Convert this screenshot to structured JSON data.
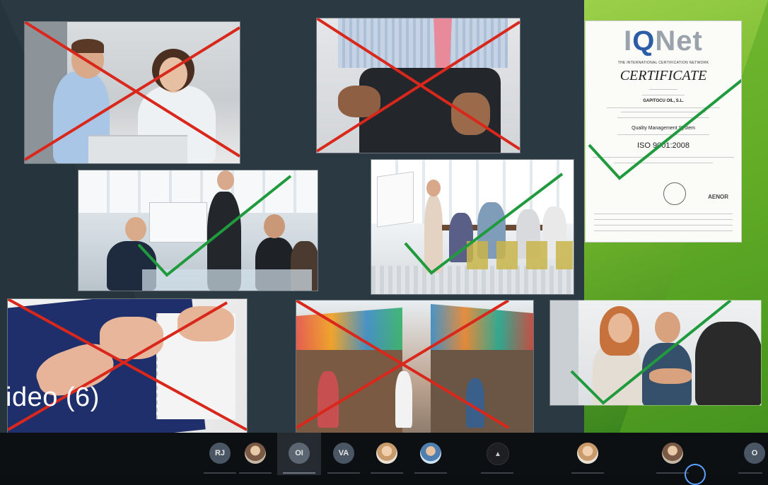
{
  "slide": {
    "caption": "ideo (6)",
    "certificate": {
      "logo_prefix": "I",
      "logo_q": "Q",
      "logo_suffix": "Net",
      "network": "THE INTERNATIONAL CERTIFICATION NETWORK",
      "title": "CERTIFICATE",
      "company": "GAPITOCU OIL, S.L.",
      "system": "Quality Management System",
      "standard": "ISO 9001:2008",
      "issuer": "AENOR"
    },
    "photos": [
      {
        "subject": "two people arguing at an office desk",
        "mark": "cross"
      },
      {
        "subject": "person with empty pockets",
        "mark": "cross"
      },
      {
        "subject": "business presentation meeting",
        "mark": "check"
      },
      {
        "subject": "team meeting around a table",
        "mark": "check"
      },
      {
        "subject": "sewing fabric by hand",
        "mark": "cross"
      },
      {
        "subject": "street market",
        "mark": "cross"
      },
      {
        "subject": "business handshake",
        "mark": "check"
      }
    ],
    "colors": {
      "cross": "#d9271c",
      "check": "#1f9a3c"
    }
  },
  "participants": [
    {
      "initials": "RJ",
      "kind": "initials"
    },
    {
      "initials": "",
      "kind": "photo"
    },
    {
      "initials": "OI",
      "kind": "initials"
    },
    {
      "initials": "VA",
      "kind": "initials"
    },
    {
      "initials": "",
      "kind": "photo"
    },
    {
      "initials": "",
      "kind": "photo"
    },
    {
      "initials": "",
      "kind": "dark"
    },
    {
      "initials": "",
      "kind": "photo"
    },
    {
      "initials": "",
      "kind": "photo"
    },
    {
      "initials": "O",
      "kind": "initials"
    }
  ]
}
